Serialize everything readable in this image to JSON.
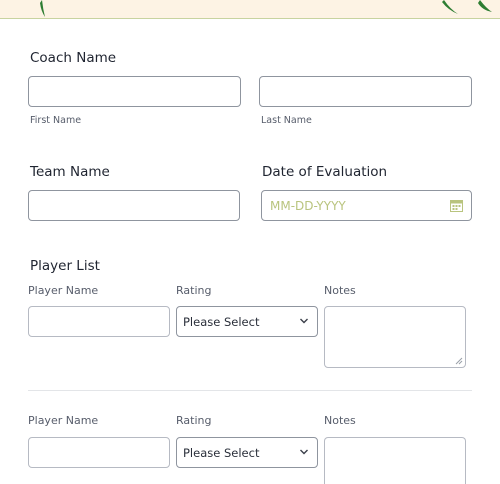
{
  "form": {
    "coach": {
      "label": "Coach Name",
      "first_sub": "First Name",
      "last_sub": "Last Name"
    },
    "team": {
      "label": "Team Name"
    },
    "date": {
      "label": "Date of Evaluation",
      "placeholder": "MM-DD-YYYY"
    },
    "player_list": {
      "label": "Player List",
      "columns": [
        "Player Name",
        "Rating",
        "Notes"
      ],
      "rows": [
        {
          "rating_value": "Please Select"
        },
        {
          "rating_value": "Please Select"
        }
      ]
    }
  },
  "colors": {
    "accent": "#b9c47e",
    "banner": "#fdf3e4",
    "logo_green": "#2e7d32"
  }
}
